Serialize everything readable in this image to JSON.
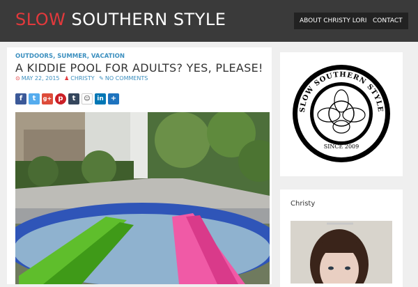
{
  "header": {
    "logo_accent": "SLOW",
    "logo_rest": " SOUTHERN STYLE",
    "nav": [
      "ABOUT CHRISTY LORIO",
      "CONTACT"
    ]
  },
  "post": {
    "categories": "OUTDOORS, SUMMER, VACATION",
    "title": "A KIDDIE POOL FOR ADULTS? YES, PLEASE!",
    "date": "MAY 22, 2015",
    "author": "CHRISTY",
    "comments": "NO COMMENTS",
    "share_icons": [
      "facebook-icon",
      "twitter-icon",
      "google-plus-icon",
      "pinterest-icon",
      "tumblr-icon",
      "reddit-icon",
      "linkedin-icon",
      "share-icon"
    ]
  },
  "sidebar": {
    "badge_top_text": "SLOW SOUTHERN STYLE",
    "badge_bottom_text": "SINCE 2009",
    "author_widget_title": "Christy"
  },
  "colors": {
    "accent_red": "#e2393c",
    "link_blue": "#3b8fbf",
    "header_bg": "#3a3a3a"
  }
}
